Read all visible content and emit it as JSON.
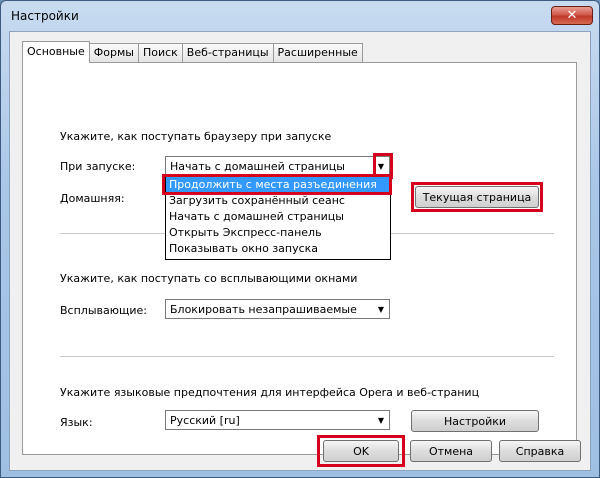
{
  "window": {
    "title": "Настройки",
    "close_glyph": "✕"
  },
  "tabs": [
    {
      "label": "Основные",
      "active": true
    },
    {
      "label": "Формы"
    },
    {
      "label": "Поиск"
    },
    {
      "label": "Веб-страницы"
    },
    {
      "label": "Расширенные"
    }
  ],
  "startup": {
    "heading": "Укажите, как поступать браузеру при запуске",
    "on_start_label": "При запуске:",
    "on_start_value": "Начать с домашней страницы",
    "home_label": "Домашняя:",
    "current_page_button": "Текущая страница",
    "options": [
      "Продолжить с места разъединения",
      "Загрузить сохранённый сеанс",
      "Начать с домашней страницы",
      "Открыть Экспресс-панель",
      "Показывать окно запуска"
    ]
  },
  "popups": {
    "heading": "Укажите, как поступать со всплывающими окнами",
    "label": "Всплывающие:",
    "value": "Блокировать незапрашиваемые"
  },
  "language": {
    "heading": "Укажите языковые предпочтения для интерфейса Opera и веб-страниц",
    "label": "Язык:",
    "value": "Русский [ru]",
    "settings_button": "Настройки"
  },
  "footer": {
    "ok": "OK",
    "cancel": "Отмена",
    "help": "Справка"
  },
  "highlight_color": "#d6001c",
  "selection_color": "#3399ff"
}
